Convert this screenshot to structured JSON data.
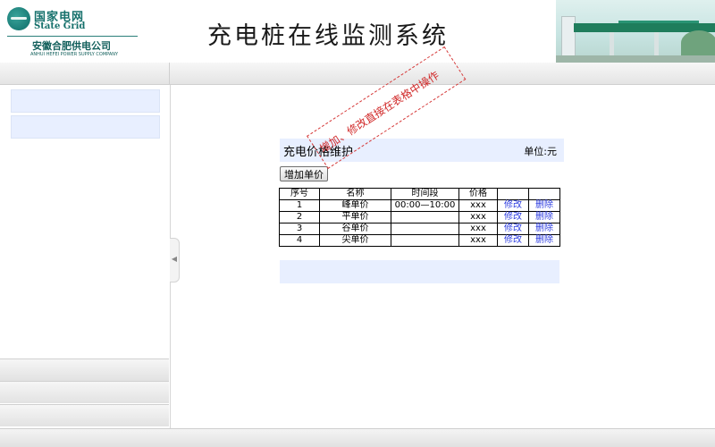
{
  "header": {
    "logo": {
      "cn": "国家电网",
      "en": "State Grid",
      "company": "安徽合肥供电公司",
      "company_en": "ANHUI HEFEI POWER SUPPLY COMPANY"
    },
    "title": "充电桩在线监测系统"
  },
  "panel": {
    "title": "充电价格维护",
    "unit": "单位:元",
    "add_button": "增加单价",
    "annotation": "增加、修改直接在表格中操作"
  },
  "table": {
    "headers": [
      "序号",
      "名称",
      "时间段",
      "价格",
      "",
      ""
    ],
    "rows": [
      {
        "no": "1",
        "name": "峰单价",
        "period": "00:00—10:00",
        "price": "xxx",
        "edit": "修改",
        "delete": "删除"
      },
      {
        "no": "2",
        "name": "平单价",
        "period": "",
        "price": "xxx",
        "edit": "修改",
        "delete": "删除"
      },
      {
        "no": "3",
        "name": "谷单价",
        "period": "",
        "price": "xxx",
        "edit": "修改",
        "delete": "删除"
      },
      {
        "no": "4",
        "name": "尖单价",
        "period": "",
        "price": "xxx",
        "edit": "修改",
        "delete": "删除"
      }
    ]
  },
  "icons": {
    "collapse": "chevron-left-icon"
  },
  "colors": {
    "panel_bg": "#e8efff",
    "link": "#2c3ce0",
    "annotation": "#d12a2a",
    "brand": "#15706b"
  }
}
